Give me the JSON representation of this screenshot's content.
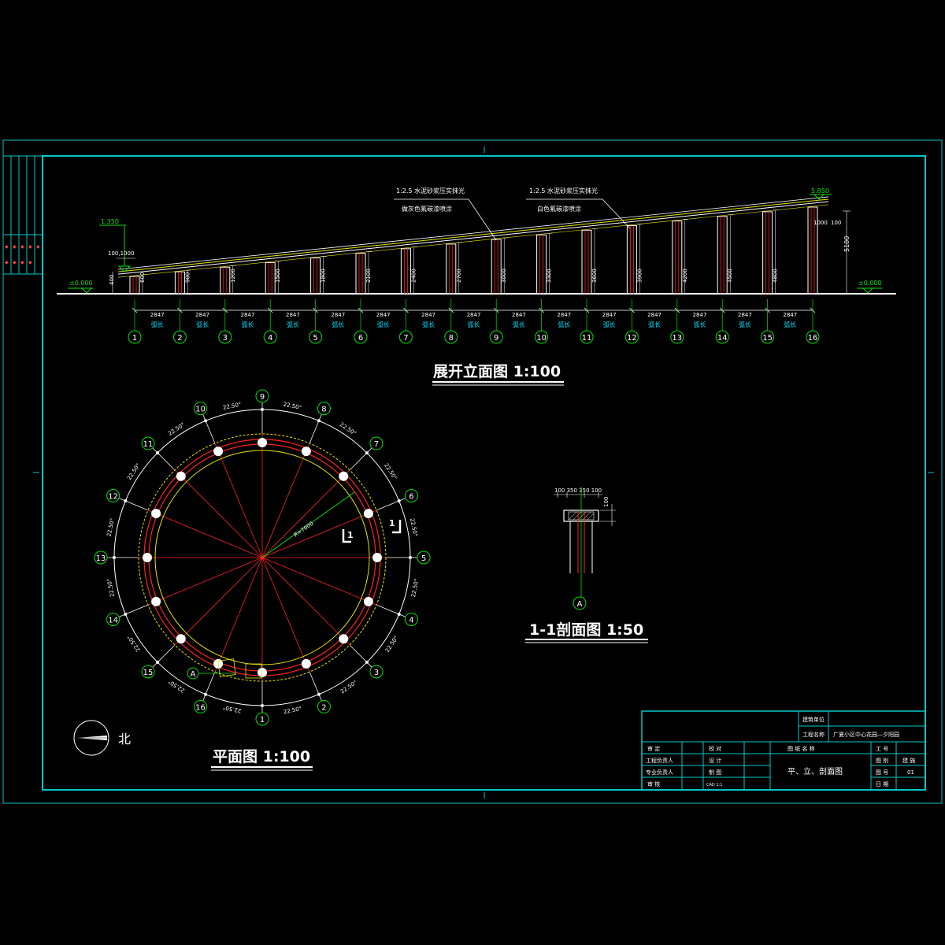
{
  "colors": {
    "frame": "#00c8c8",
    "red": "#ff2020",
    "green": "#00e000",
    "yellow": "#e6e600",
    "white": "#ffffff",
    "cyan": "#00e0ff"
  },
  "elevation": {
    "title": "展开立面图 1:100",
    "note1_line1": "1:2.5 水泥砂浆压实抹光",
    "note1_line2": "做灰色氟碳漆喷涂",
    "note2_line1": "1:2.5 水泥砂浆压实抹光",
    "note2_line2": "白色氟碳漆喷涂",
    "level_left": "1.350",
    "level_right": "5.850",
    "ground_left": "±0.000",
    "ground_right": "±0.000",
    "dim_top_left": "100,1000",
    "dim_left_400": "400",
    "dim_right_top": "1000",
    "dim_right_100": "100",
    "dim_right_total": "5100",
    "span": "2847",
    "arc_label": "弧长",
    "columns": [
      "1",
      "2",
      "3",
      "4",
      "5",
      "6",
      "7",
      "8",
      "9",
      "10",
      "11",
      "12",
      "13",
      "14",
      "15",
      "16"
    ],
    "heights": [
      "600",
      "900",
      "1200",
      "1500",
      "1800",
      "2100",
      "2400",
      "2700",
      "3000",
      "3300",
      "3600",
      "3900",
      "4200",
      "4500",
      "4800",
      ""
    ]
  },
  "plan": {
    "title": "平面图 1:100",
    "angle": "22.50°",
    "radius_label": "R=7000",
    "section_marker": "1",
    "axis_a": "A",
    "north": "北",
    "axes": [
      "1",
      "2",
      "3",
      "4",
      "5",
      "6",
      "7",
      "8",
      "9",
      "10",
      "11",
      "12",
      "13",
      "14",
      "15",
      "16"
    ]
  },
  "section": {
    "title": "1-1剖面图 1:50",
    "dims": "100 350 350 100",
    "dim_side": "100",
    "axis": "A"
  },
  "title_block": {
    "unit_label": "建筑单位",
    "unit_value": "",
    "project_label": "工程名称",
    "project_value": "广夏小区中心花园—夕阳园",
    "r1": [
      "审 定",
      "校 对",
      "图 纸 名 称",
      "工 号"
    ],
    "r2": [
      "工程负责人",
      "设 计",
      "图 别",
      "建 施"
    ],
    "r3": [
      "专业负责人",
      "制 图",
      "图 号",
      "01"
    ],
    "r4": [
      "审 核",
      "CAD 1:1",
      "日 期"
    ],
    "drawing_name": "平、立、剖面图"
  }
}
